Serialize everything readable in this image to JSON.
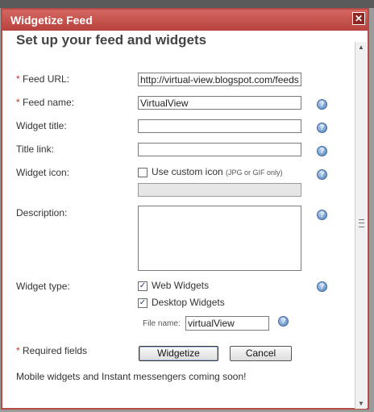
{
  "dialog": {
    "title": "Widgetize Feed",
    "close_glyph": "✕",
    "heading": "Set up your feed and widgets"
  },
  "form": {
    "required_marker": "*",
    "feed_url": {
      "label": "Feed URL:",
      "value": "http://virtual-view.blogspot.com/feeds"
    },
    "feed_name": {
      "label": "Feed name:",
      "value": "VirtualView"
    },
    "widget_title": {
      "label": "Widget title:",
      "value": ""
    },
    "title_link": {
      "label": "Title link:",
      "value": ""
    },
    "widget_icon": {
      "label": "Widget icon:",
      "checkbox_label": "Use custom icon",
      "checkbox_hint": "(JPG or GIF only)",
      "checked": false,
      "path_value": ""
    },
    "description": {
      "label": "Description:",
      "value": ""
    },
    "widget_type": {
      "label": "Widget type:",
      "web_widgets": {
        "label": "Web Widgets",
        "checked": true
      },
      "desktop_widgets": {
        "label": "Desktop Widgets",
        "checked": true
      },
      "file_name_label": "File name:",
      "file_name_value": "virtualView"
    },
    "required_fields_note": "Required fields",
    "buttons": {
      "widgetize": "Widgetize",
      "cancel": "Cancel"
    },
    "footer_note": "Mobile widgets and Instant messengers coming soon!"
  },
  "icons": {
    "help": "help-question-icon",
    "check": "✓",
    "help_glyph": "?"
  },
  "colors": {
    "titlebar": "#c8544f",
    "border": "#b84a45",
    "required": "#c0392b"
  }
}
